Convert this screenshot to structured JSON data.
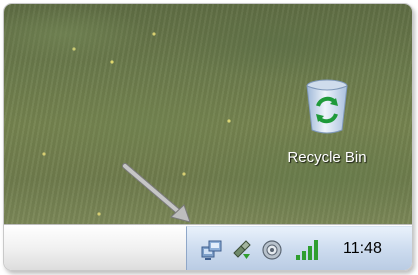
{
  "desktop": {
    "icons": [
      {
        "label": "Recycle Bin",
        "icon": "recycle-bin-icon"
      }
    ]
  },
  "annotation": {
    "icon": "pointer-arrow",
    "color": "#b9b9b9"
  },
  "tray": {
    "icons": [
      "network-icon",
      "safely-remove-hardware-icon",
      "volume-icon",
      "signal-strength-icon"
    ],
    "clock": "11:48"
  },
  "colors": {
    "tray_bg": "#cddcef",
    "taskbar_bg": "#f1f1f1",
    "signal_green": "#2f9e2f"
  }
}
